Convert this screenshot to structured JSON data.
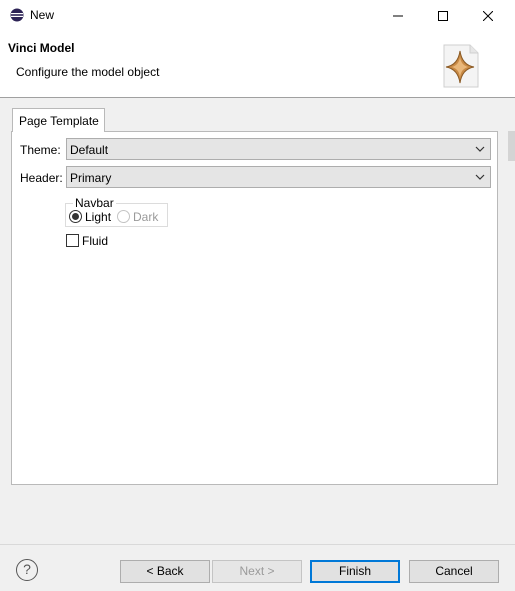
{
  "window": {
    "title": "New",
    "minimize_icon": "minimize-icon",
    "maximize_icon": "maximize-icon",
    "close_icon": "close-icon"
  },
  "banner": {
    "title": "Vinci Model",
    "description": "Configure the model object",
    "icon": "wizard-star-icon"
  },
  "tabs": [
    {
      "label": "Page Template",
      "selected": true
    }
  ],
  "form": {
    "theme": {
      "label": "Theme:",
      "value": "Default"
    },
    "header": {
      "label": "Header:",
      "value": "Primary"
    },
    "navbar": {
      "label": "Navbar",
      "options": [
        {
          "label": "Light",
          "selected": true,
          "enabled": true
        },
        {
          "label": "Dark",
          "selected": false,
          "enabled": false
        }
      ]
    },
    "fluid": {
      "label": "Fluid",
      "checked": false
    }
  },
  "footer": {
    "help_icon": "help-icon",
    "help_glyph": "?",
    "back_label": "< Back",
    "next_label": "Next >",
    "finish_label": "Finish",
    "cancel_label": "Cancel"
  },
  "colors": {
    "accent": "#0078d7",
    "dialog_bg": "#f0f0f0",
    "panel_bg": "#ffffff"
  }
}
